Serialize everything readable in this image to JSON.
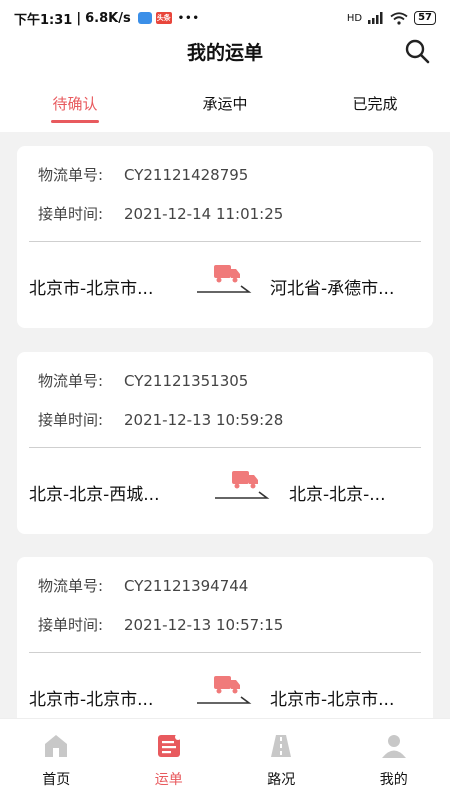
{
  "status_bar": {
    "time": "下午1:31",
    "speed": "6.8K/s",
    "app_badge_text": "头条",
    "dots": "•••",
    "signal_text": "HD",
    "battery": "57"
  },
  "header": {
    "title": "我的运单",
    "search_icon": "search-icon"
  },
  "tabs": [
    {
      "label": "待确认",
      "active": true
    },
    {
      "label": "承运中",
      "active": false
    },
    {
      "label": "已完成",
      "active": false
    }
  ],
  "orders": [
    {
      "tracking_label": "物流单号:",
      "tracking_no": "CY21121428795",
      "time_label": "接单时间:",
      "time": "2021-12-14 11:01:25",
      "from": "北京市-北京市...",
      "to": "河北省-承德市..."
    },
    {
      "tracking_label": "物流单号:",
      "tracking_no": "CY21121351305",
      "time_label": "接单时间:",
      "time": "2021-12-13 10:59:28",
      "from": "北京-北京-西城...",
      "to": "北京-北京-..."
    },
    {
      "tracking_label": "物流单号:",
      "tracking_no": "CY21121394744",
      "time_label": "接单时间:",
      "time": "2021-12-13 10:57:15",
      "from": "北京市-北京市...",
      "to": "北京市-北京市..."
    }
  ],
  "bottom_nav": [
    {
      "label": "首页",
      "icon": "home-icon",
      "active": false
    },
    {
      "label": "运单",
      "icon": "waybill-icon",
      "active": true
    },
    {
      "label": "路况",
      "icon": "road-icon",
      "active": false
    },
    {
      "label": "我的",
      "icon": "profile-icon",
      "active": false
    }
  ],
  "colors": {
    "accent": "#e85a5e",
    "truck": "#f07a7a",
    "inactive_icon": "#c8c8c8"
  }
}
